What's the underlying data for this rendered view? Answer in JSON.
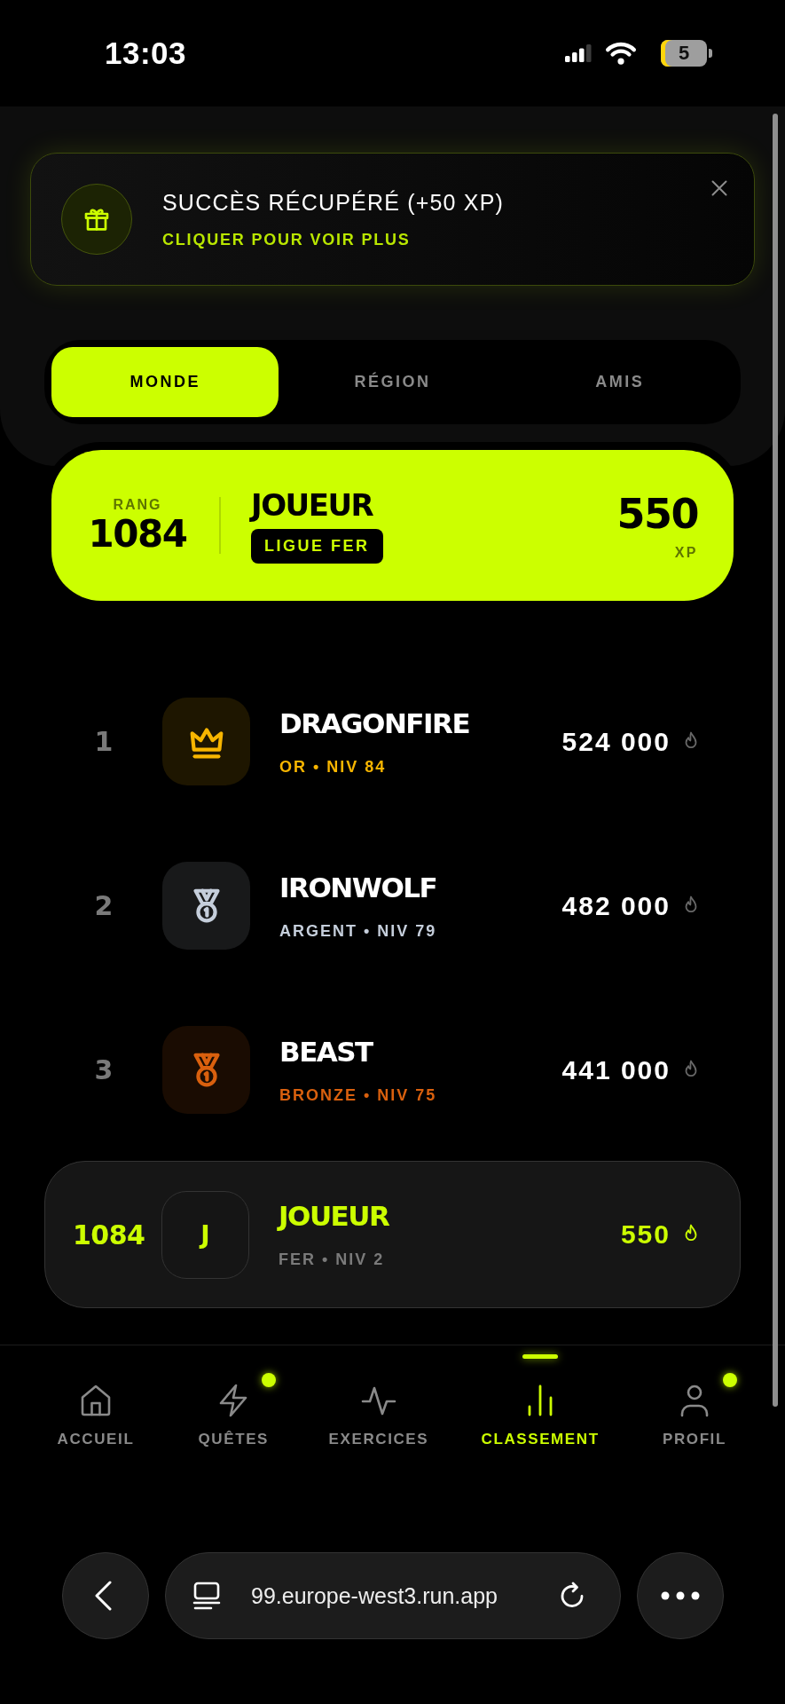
{
  "status_bar": {
    "time": "13:03",
    "battery": "5"
  },
  "toast": {
    "title": "SUCCÈS RÉCUPÉRÉ (+50 XP)",
    "action": "CLIQUER POUR VOIR PLUS"
  },
  "tabs": [
    {
      "label": "MONDE",
      "selected": true
    },
    {
      "label": "RÉGION",
      "selected": false
    },
    {
      "label": "AMIS",
      "selected": false
    }
  ],
  "player_card": {
    "rank_label": "RANG",
    "rank": "1084",
    "name": "JOUEUR",
    "league": "LIGUE FER",
    "score": "550",
    "unit": "XP"
  },
  "leaderboard": [
    {
      "rank": "1",
      "kind": "crown",
      "color": "#f7b500",
      "name": "DRAGONFIRE",
      "meta": "OR • NIV 84",
      "score": "524 000"
    },
    {
      "rank": "2",
      "kind": "medal",
      "color": "#c5cedb",
      "name": "IRONWOLF",
      "meta": "ARGENT • NIV 79",
      "score": "482 000"
    },
    {
      "rank": "3",
      "kind": "medal",
      "color": "#d9600e",
      "name": "BEAST",
      "meta": "BRONZE • NIV 75",
      "score": "441 000"
    }
  ],
  "my_row": {
    "rank": "1084",
    "initial": "J",
    "name": "JOUEUR",
    "meta": "FER • NIV 2",
    "score": "550"
  },
  "bottom_nav": [
    {
      "label": "ACCUEIL",
      "kind": "home",
      "selected": false,
      "badge": false
    },
    {
      "label": "QUÊTES",
      "kind": "bolt",
      "selected": false,
      "badge": true
    },
    {
      "label": "EXERCICES",
      "kind": "pulse",
      "selected": false,
      "badge": false
    },
    {
      "label": "CLASSEMENT",
      "kind": "chart",
      "selected": true,
      "badge": false
    },
    {
      "label": "PROFIL",
      "kind": "user",
      "selected": false,
      "badge": true
    }
  ],
  "browser": {
    "url": "99.europe-west3.run.app"
  }
}
